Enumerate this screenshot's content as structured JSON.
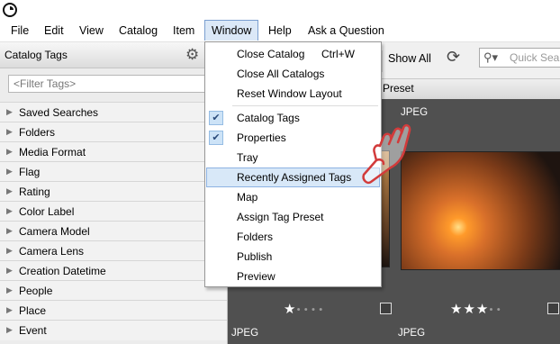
{
  "menubar": [
    "File",
    "Edit",
    "View",
    "Catalog",
    "Item",
    "Window",
    "Help",
    "Ask a Question"
  ],
  "panel": {
    "title": "Catalog Tags",
    "filter_placeholder": "<Filter Tags>",
    "tags": [
      "Saved Searches",
      "Folders",
      "Media Format",
      "Flag",
      "Rating",
      "Color Label",
      "Camera Model",
      "Camera Lens",
      "Creation Datetime",
      "People",
      "Place",
      "Event"
    ]
  },
  "toolbar": {
    "show_all": "Show All",
    "quick_search": "Quick Search"
  },
  "column_header": "Preset",
  "grid": {
    "label_top": "JPEG",
    "label_bottom_left": "JPEG",
    "label_bottom_right": "JPEG",
    "rating_left": 1,
    "rating_right": 3
  },
  "window_menu": {
    "items": [
      {
        "label": "Close Catalog",
        "shortcut": "Ctrl+W"
      },
      {
        "label": "Close All Catalogs"
      },
      {
        "label": "Reset Window Layout"
      },
      {
        "label": "Catalog Tags",
        "checked": true
      },
      {
        "label": "Properties",
        "checked": true
      },
      {
        "label": "Tray"
      },
      {
        "label": "Recently Assigned Tags",
        "highlighted": true
      },
      {
        "label": "Map"
      },
      {
        "label": "Assign Tag Preset"
      },
      {
        "label": "Folders"
      },
      {
        "label": "Publish"
      },
      {
        "label": "Preview"
      }
    ]
  },
  "colors": {
    "menu_highlight": "#d8e8f8",
    "grid_bg": "#505050",
    "pointer": "#d23b3b"
  }
}
